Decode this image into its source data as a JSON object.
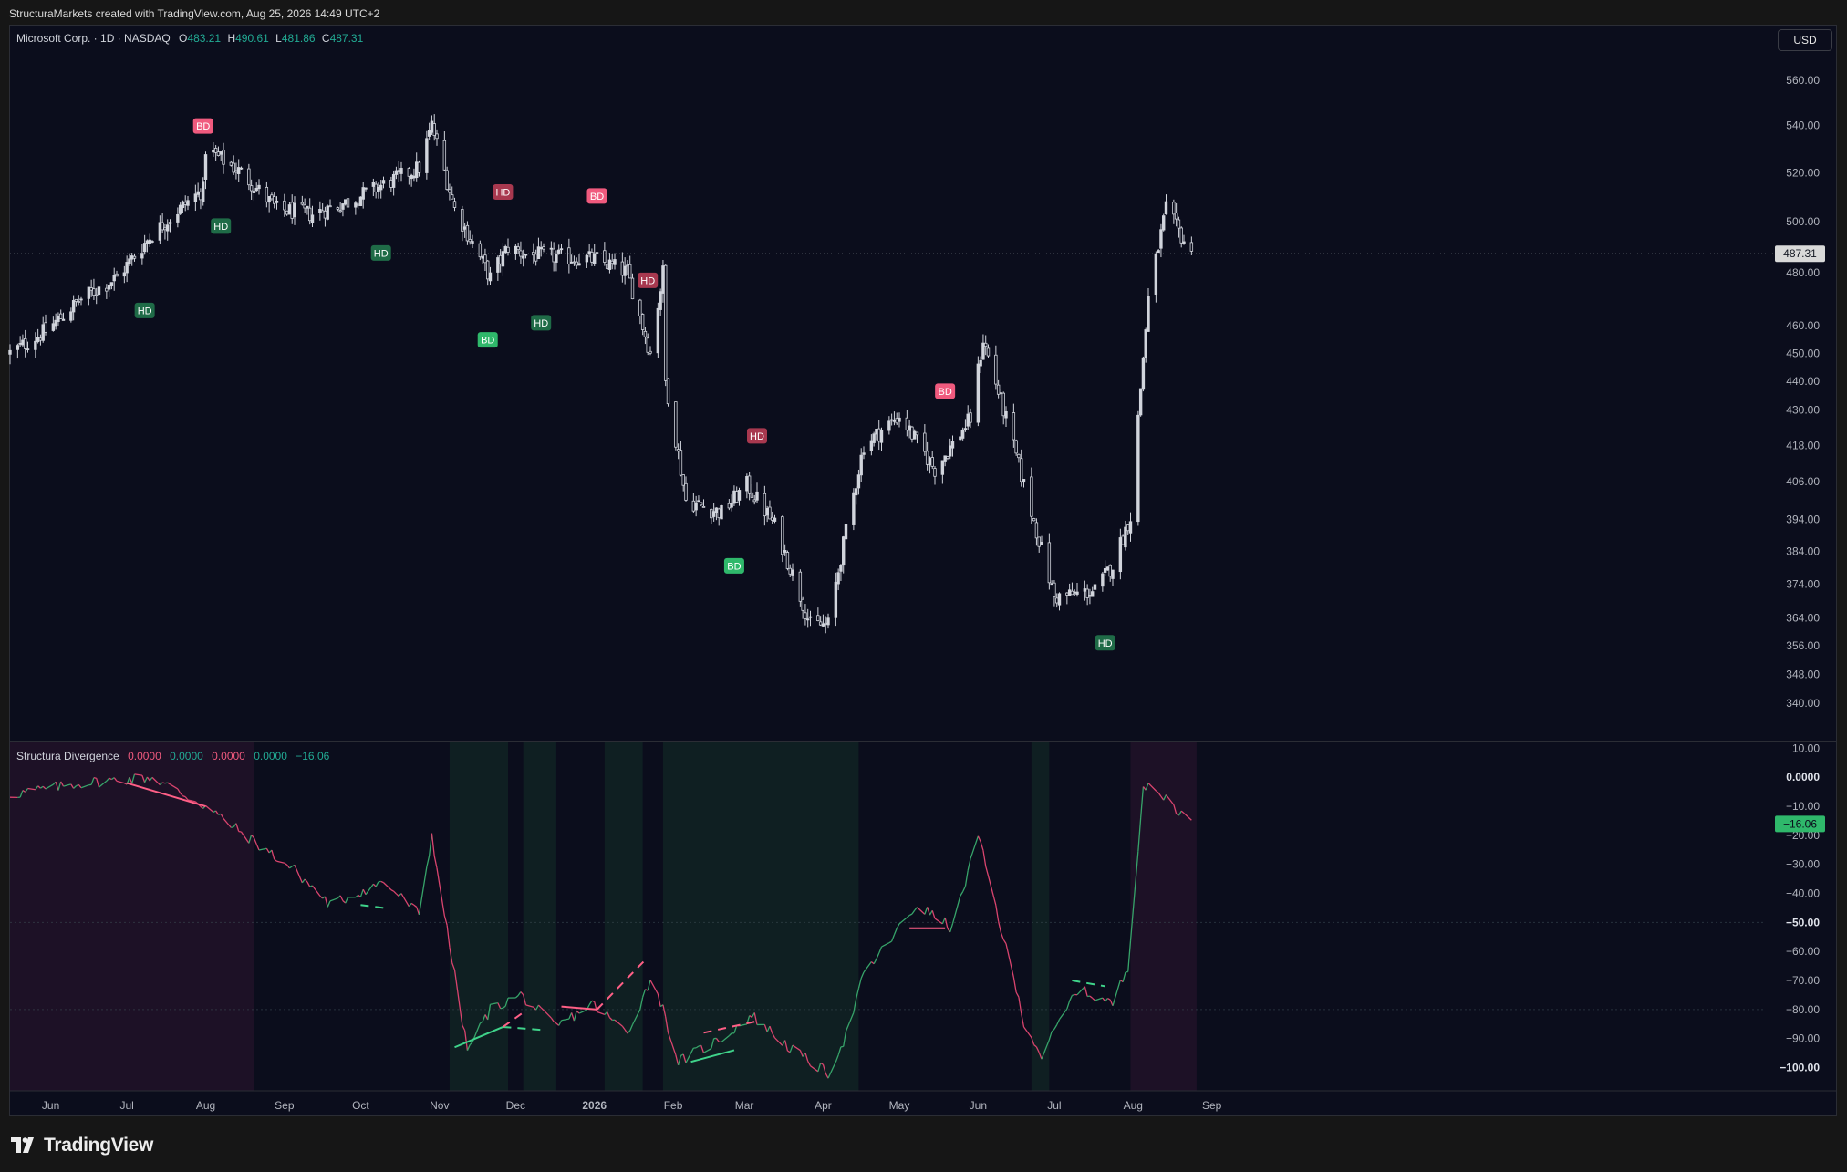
{
  "header": {
    "watermark": "StructuraMarkets created with TradingView.com, Aug 25, 2026 14:49 UTC+2"
  },
  "main_legend": {
    "symbol": "Microsoft Corp. · 1D · NASDAQ",
    "o_label": "O",
    "o_value": "483.21",
    "h_label": "H",
    "h_value": "490.61",
    "l_label": "L",
    "l_value": "481.86",
    "c_label": "C",
    "c_value": "487.31"
  },
  "indicator_legend": {
    "name": "Structura Divergence",
    "v1": "0.0000",
    "v2": "0.0000",
    "v3": "0.0000",
    "v4": "0.0000",
    "v5": "−16.06"
  },
  "currency_button": "USD",
  "footer": {
    "logo_text": "TradingView"
  },
  "colors": {
    "background": "#0b0d1c",
    "candle": "#d1d4dc",
    "bull_label": "#2fb86b",
    "hidden_bull_label": "#1f6b47",
    "bear_label": "#f05a7e",
    "hidden_bear_label": "#a8384f",
    "osc_bull": "#37a46a",
    "osc_bear": "#d9446e",
    "bull_zone": "#0f1f22",
    "bear_zone": "#1d1126"
  },
  "chart_data": [
    {
      "type": "candlestick",
      "title": "Microsoft Corp. · 1D · NASDAQ",
      "scale": "log",
      "ylim": [
        330,
        585
      ],
      "y_ticks": [
        "560.00",
        "540.00",
        "520.00",
        "500.00",
        "480.00",
        "460.00",
        "450.00",
        "440.00",
        "430.00",
        "418.00",
        "406.00",
        "394.00",
        "384.00",
        "374.00",
        "364.00",
        "356.00",
        "348.00",
        "340.00"
      ],
      "x_ticks": [
        "Jun",
        "Jul",
        "Aug",
        "Sep",
        "Oct",
        "Nov",
        "Dec",
        "2026",
        "Feb",
        "Mar",
        "Apr",
        "May",
        "Jun",
        "Jul",
        "Aug",
        "Sep"
      ],
      "last_price": "487.31",
      "series": [
        {
          "x": [
            "2025-05-16",
            "2025-05-30",
            "2025-06-13",
            "2025-06-27",
            "2025-07-11",
            "2025-07-25",
            "2025-07-31",
            "2025-08-01",
            "2025-08-15",
            "2025-08-29",
            "2025-09-12",
            "2025-09-26",
            "2025-10-10",
            "2025-10-24",
            "2025-10-29",
            "2025-11-07",
            "2025-11-21",
            "2025-11-28",
            "2025-12-05",
            "2025-12-19",
            "2026-01-02",
            "2026-01-14",
            "2026-01-23",
            "2026-01-28",
            "2026-01-29",
            "2026-02-06",
            "2026-02-20",
            "2026-03-02",
            "2026-03-13",
            "2026-03-27",
            "2026-04-03",
            "2026-04-17",
            "2026-05-01",
            "2026-05-15",
            "2026-05-29",
            "2026-06-03",
            "2026-06-19",
            "2026-07-01",
            "2026-07-17",
            "2026-07-24",
            "2026-07-31",
            "2026-08-07",
            "2026-08-14",
            "2026-08-24"
          ],
          "values": [
            450,
            458,
            470,
            478,
            495,
            508,
            513,
            530,
            520,
            505,
            503,
            508,
            515,
            522,
            540,
            505,
            478,
            490,
            487,
            486,
            485,
            480,
            450,
            480,
            440,
            400,
            396,
            405,
            392,
            362,
            362,
            418,
            428,
            410,
            427,
            455,
            405,
            370,
            372,
            380,
            395,
            470,
            505,
            487
          ]
        }
      ],
      "annotations": [
        {
          "label": "HD",
          "kind": "hidden-bullish",
          "date": "2025-07-08"
        },
        {
          "label": "BD",
          "kind": "bearish",
          "date": "2025-07-31"
        },
        {
          "label": "HD",
          "kind": "hidden-bullish",
          "date": "2025-08-07"
        },
        {
          "label": "HD",
          "kind": "hidden-bullish",
          "date": "2025-10-09"
        },
        {
          "label": "BD",
          "kind": "bullish",
          "date": "2025-11-20"
        },
        {
          "label": "HD",
          "kind": "hidden-bearish",
          "date": "2025-11-26"
        },
        {
          "label": "HD",
          "kind": "hidden-bullish",
          "date": "2025-12-11"
        },
        {
          "label": "BD",
          "kind": "bearish",
          "date": "2026-01-02"
        },
        {
          "label": "HD",
          "kind": "hidden-bearish",
          "date": "2026-01-22"
        },
        {
          "label": "BD",
          "kind": "bullish",
          "date": "2026-02-25"
        },
        {
          "label": "HD",
          "kind": "hidden-bearish",
          "date": "2026-03-06"
        },
        {
          "label": "BD",
          "kind": "bearish",
          "date": "2026-05-19"
        },
        {
          "label": "HD",
          "kind": "hidden-bullish",
          "date": "2026-07-21"
        }
      ]
    },
    {
      "type": "line",
      "title": "Structura Divergence",
      "ylim": [
        -108,
        12
      ],
      "y_ticks": [
        "10.00",
        "0.0000",
        "−10.00",
        "−20.00",
        "−30.00",
        "−40.00",
        "−50.00",
        "−60.00",
        "−70.00",
        "−80.00",
        "−90.00",
        "−100.00"
      ],
      "last_value": "−16.06",
      "series": [
        {
          "x": [
            "2025-05-16",
            "2025-06-13",
            "2025-07-11",
            "2025-08-01",
            "2025-08-15",
            "2025-09-05",
            "2025-09-19",
            "2025-10-10",
            "2025-10-24",
            "2025-10-29",
            "2025-11-05",
            "2025-11-12",
            "2025-11-21",
            "2025-12-03",
            "2025-12-17",
            "2025-12-31",
            "2026-01-14",
            "2026-01-24",
            "2026-02-03",
            "2026-02-20",
            "2026-03-04",
            "2026-03-20",
            "2026-04-03",
            "2026-04-10",
            "2026-04-17",
            "2026-05-08",
            "2026-05-22",
            "2026-06-01",
            "2026-06-19",
            "2026-06-26",
            "2026-07-10",
            "2026-07-24",
            "2026-07-30",
            "2026-08-05",
            "2026-08-14",
            "2026-08-24"
          ],
          "values": [
            -6,
            -2,
            0,
            -10,
            -19,
            -32,
            -44,
            -36,
            -47,
            -20,
            -58,
            -94,
            -80,
            -75,
            -86,
            -78,
            -88,
            -68,
            -98,
            -90,
            -82,
            -94,
            -102,
            -89,
            -68,
            -44,
            -52,
            -20,
            -84,
            -96,
            -73,
            -78,
            -65,
            -3,
            -7,
            -16
          ]
        }
      ],
      "divergence_lines": [
        {
          "kind": "bearish",
          "from": [
            "2025-07-01",
            -2
          ],
          "to": [
            "2025-08-01",
            -10
          ]
        },
        {
          "kind": "hidden-bullish-dashed",
          "from": [
            "2025-10-01",
            -44
          ],
          "to": [
            "2025-10-10",
            -45
          ]
        },
        {
          "kind": "bullish",
          "from": [
            "2025-11-07",
            -93
          ],
          "to": [
            "2025-11-26",
            -86
          ]
        },
        {
          "kind": "hidden-bullish-dashed",
          "from": [
            "2025-11-26",
            -86
          ],
          "to": [
            "2025-12-11",
            -87
          ]
        },
        {
          "kind": "hidden-bearish-dashed",
          "from": [
            "2025-11-26",
            -86
          ],
          "to": [
            "2025-12-04",
            -81
          ]
        },
        {
          "kind": "bearish",
          "from": [
            "2025-12-19",
            -79
          ],
          "to": [
            "2026-01-02",
            -80
          ]
        },
        {
          "kind": "hidden-bearish-dashed",
          "from": [
            "2026-01-02",
            -80
          ],
          "to": [
            "2026-01-22",
            -62
          ]
        },
        {
          "kind": "bullish",
          "from": [
            "2026-02-08",
            -98
          ],
          "to": [
            "2026-02-25",
            -94
          ]
        },
        {
          "kind": "hidden-bearish-dashed",
          "from": [
            "2026-02-13",
            -88
          ],
          "to": [
            "2026-03-06",
            -84
          ]
        },
        {
          "kind": "bearish",
          "from": [
            "2026-05-05",
            -52
          ],
          "to": [
            "2026-05-19",
            -52
          ]
        },
        {
          "kind": "hidden-bullish-dashed",
          "from": [
            "2026-07-08",
            -70
          ],
          "to": [
            "2026-07-21",
            -72
          ]
        }
      ],
      "zones": [
        {
          "kind": "bearish",
          "from": "2025-05-16",
          "to": "2025-08-20"
        },
        {
          "kind": "bullish",
          "from": "2025-11-05",
          "to": "2025-11-28"
        },
        {
          "kind": "bullish",
          "from": "2025-12-04",
          "to": "2025-12-17"
        },
        {
          "kind": "bullish",
          "from": "2026-01-05",
          "to": "2026-01-20"
        },
        {
          "kind": "bullish",
          "from": "2026-01-28",
          "to": "2026-04-15"
        },
        {
          "kind": "bullish",
          "from": "2026-06-22",
          "to": "2026-06-29"
        },
        {
          "kind": "bearish",
          "from": "2026-07-31",
          "to": "2026-08-26"
        }
      ]
    }
  ]
}
